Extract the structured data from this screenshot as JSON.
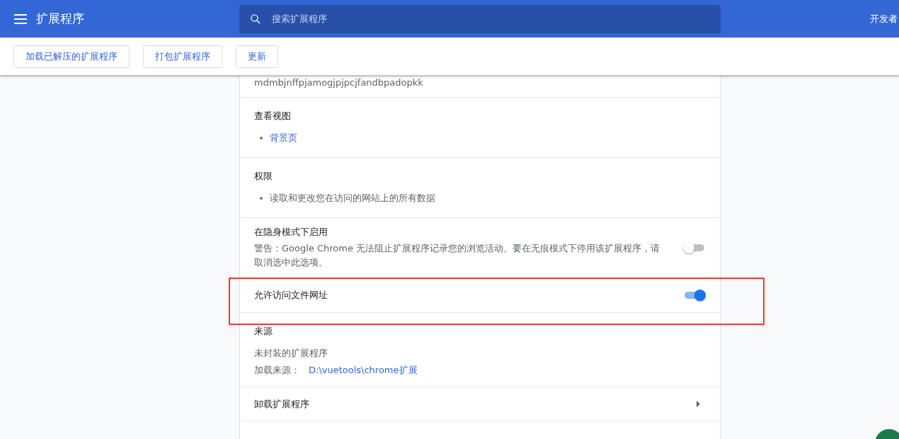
{
  "header": {
    "title": "扩展程序",
    "search_placeholder": "搜索扩展程序",
    "developer_mode_label": "开发者"
  },
  "toolbar_buttons": [
    "加载已解压的扩展程序",
    "打包扩展程序",
    "更新"
  ],
  "sections": [
    {
      "kind": "id",
      "text": "mdmbjnffpjamogjpjpcjfandbpadopkk"
    },
    {
      "kind": "list",
      "title": "查看视图",
      "items": [
        {
          "text": "背景页",
          "link": true
        }
      ]
    },
    {
      "kind": "list",
      "title": "权限",
      "items": [
        {
          "text": "读取和更改您在访问的网站上的所有数据",
          "link": false
        }
      ]
    },
    {
      "kind": "toggle",
      "title": "在隐身模式下启用",
      "description": "警告：Google Chrome 无法阻止扩展程序记录您的浏览活动。要在无痕模式下停用该扩展程序，请取消选中此选项。",
      "on": false
    },
    {
      "kind": "toggle",
      "title": "允许访问文件网址",
      "on": true,
      "highlighted": true
    },
    {
      "kind": "source",
      "title": "来源",
      "type": "未封装的扩展程序",
      "location_label": "加载来源：",
      "location": "D:\\vuetools\\chrome扩展"
    },
    {
      "kind": "link",
      "title": "卸载扩展程序"
    }
  ]
}
